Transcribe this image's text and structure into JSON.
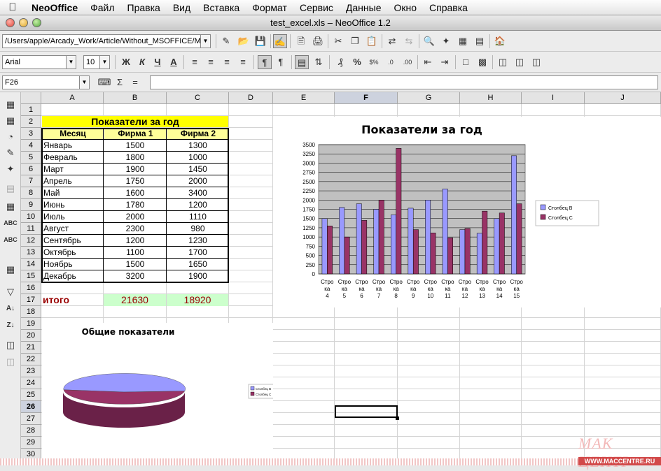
{
  "menubar": {
    "app": "NeoOffice",
    "items": [
      "Файл",
      "Правка",
      "Вид",
      "Вставка",
      "Формат",
      "Сервис",
      "Данные",
      "Окно",
      "Справка"
    ]
  },
  "window": {
    "title": "test_excel.xls – NeoOffice 1.2"
  },
  "toolbar": {
    "path": "/Users/apple/Arcady_Work/Article/Without_MSOFFICE/M",
    "font_name": "Arial",
    "font_size": "10",
    "bold": "Ж",
    "italic": "К",
    "underline": "Ч",
    "sum_symbol": "Σ",
    "equals_symbol": "="
  },
  "formula": {
    "cell_ref": "F26",
    "content": ""
  },
  "columns": [
    "A",
    "B",
    "C",
    "D",
    "E",
    "F",
    "G",
    "H",
    "I",
    "J"
  ],
  "selected_column": "F",
  "selected_row": "26",
  "rows": [
    "1",
    "2",
    "3",
    "4",
    "5",
    "6",
    "7",
    "8",
    "9",
    "10",
    "11",
    "12",
    "13",
    "14",
    "15",
    "16",
    "17",
    "18",
    "19",
    "20",
    "21",
    "22",
    "23",
    "24",
    "25",
    "26",
    "27",
    "28",
    "29",
    "30"
  ],
  "table": {
    "title": "Показатели за год",
    "headers": [
      "Месяц",
      "Фирма 1",
      "Фирма 2"
    ],
    "rows": [
      [
        "Январь",
        "1500",
        "1300"
      ],
      [
        "Февраль",
        "1800",
        "1000"
      ],
      [
        "Март",
        "1900",
        "1450"
      ],
      [
        "Апрель",
        "1750",
        "2000"
      ],
      [
        "Май",
        "1600",
        "3400"
      ],
      [
        "Июнь",
        "1780",
        "1200"
      ],
      [
        "Июль",
        "2000",
        "1110"
      ],
      [
        "Август",
        "2300",
        "980"
      ],
      [
        "Сентябрь",
        "1200",
        "1230"
      ],
      [
        "Октябрь",
        "1100",
        "1700"
      ],
      [
        "Ноябрь",
        "1500",
        "1650"
      ],
      [
        "Декабрь",
        "3200",
        "1900"
      ]
    ],
    "total_label": "итого",
    "total_1": "21630",
    "total_2": "18920"
  },
  "chart_data": [
    {
      "type": "bar",
      "title": "Показатели за год",
      "categories": [
        "Стро ка 4",
        "Стро ка 5",
        "Стро ка 6",
        "Стро ка 7",
        "Стро ка 8",
        "Стро ка 9",
        "Стро ка 10",
        "Стро ка 11",
        "Стро ка 12",
        "Стро ка 13",
        "Стро ка 14",
        "Стро ка 15"
      ],
      "series": [
        {
          "name": "Столбец B",
          "values": [
            1500,
            1800,
            1900,
            1750,
            1600,
            1780,
            2000,
            2300,
            1200,
            1100,
            1500,
            3200
          ],
          "color": "#9999ff"
        },
        {
          "name": "Столбец C",
          "values": [
            1300,
            1000,
            1450,
            2000,
            3400,
            1200,
            1110,
            980,
            1230,
            1700,
            1650,
            1900
          ],
          "color": "#993366"
        }
      ],
      "ylim": [
        0,
        3500
      ],
      "ticks": [
        0,
        250,
        500,
        750,
        1000,
        1250,
        1500,
        1750,
        2000,
        2250,
        2500,
        2750,
        3000,
        3250,
        3500
      ],
      "grid": true,
      "legend": "right"
    },
    {
      "type": "pie",
      "title": "Общие показатели",
      "labels": [
        "Столбец B",
        "Столбец C"
      ],
      "values": [
        21630,
        18920
      ],
      "colors": [
        "#9999ff",
        "#993366"
      ],
      "legend": "right"
    }
  ],
  "watermark": {
    "logo": "МАК ЦЕНТР",
    "url": "WWW.MACCENTRE.RU"
  }
}
